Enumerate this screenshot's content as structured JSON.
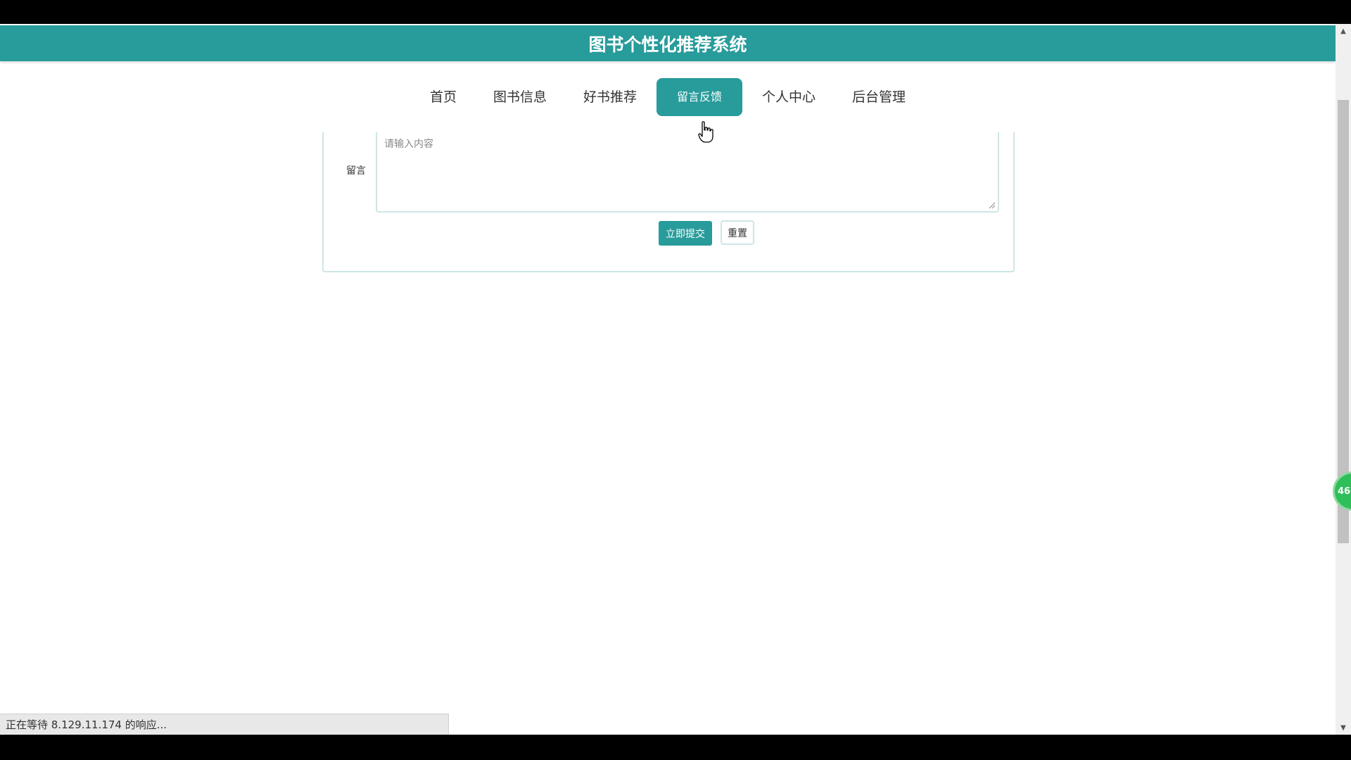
{
  "header": {
    "title": "图书个性化推荐系统"
  },
  "nav": {
    "items": [
      {
        "label": "首页"
      },
      {
        "label": "图书信息"
      },
      {
        "label": "好书推荐"
      },
      {
        "label": "留言反馈"
      },
      {
        "label": "个人中心"
      },
      {
        "label": "后台管理"
      }
    ],
    "active_index": 3
  },
  "form": {
    "message_label": "留言",
    "message_placeholder": "请输入内容",
    "message_value": "",
    "submit_label": "立即提交",
    "reset_label": "重置"
  },
  "floating_badge": {
    "text": "46"
  },
  "status_bar": {
    "text": "正在等待 8.129.11.174 的响应..."
  },
  "colors": {
    "accent": "#289b9b",
    "border": "#cde6e6",
    "badge": "#2fbf5a"
  }
}
